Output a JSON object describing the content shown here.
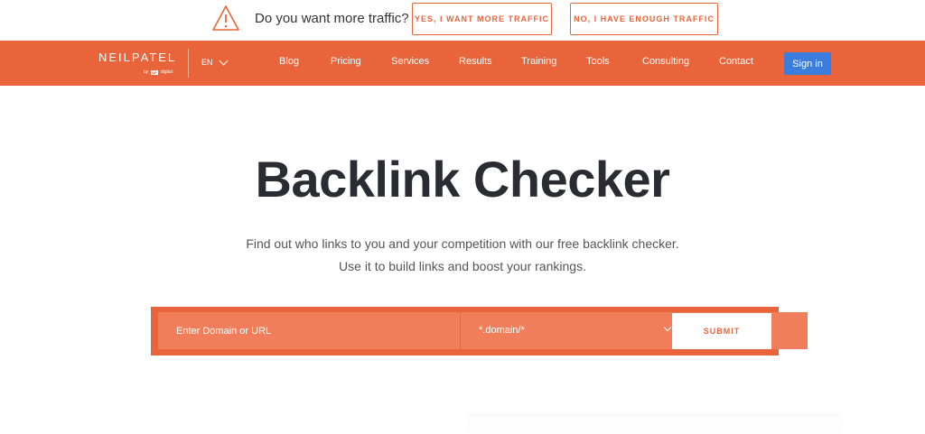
{
  "topbar": {
    "question": "Do you want more traffic?",
    "yes_label": "YES, I WANT MORE TRAFFIC",
    "no_label": "NO, I HAVE ENOUGH TRAFFIC",
    "icon": "warning-triangle-icon"
  },
  "navbar": {
    "logo_text": "NEILPATEL",
    "logo_by": "by",
    "logo_badge": "NP",
    "logo_digital": "digital",
    "language": "EN",
    "items": [
      "Blog",
      "Pricing",
      "Services",
      "Results",
      "Training",
      "Tools",
      "Consulting",
      "Contact"
    ],
    "signin_label": "Sign in"
  },
  "hero": {
    "title": "Backlink Checker",
    "subtitle_line1": "Find out who links to you and your competition with our free backlink checker.",
    "subtitle_line2": "Use it to build links and boost your rankings."
  },
  "form": {
    "input_placeholder": "Enter Domain or URL",
    "select_value": "*.domain/*",
    "submit_label": "SUBMIT"
  },
  "colors": {
    "brand_orange": "#e9643a",
    "input_orange": "#f07e5a",
    "signin_blue": "#3b7ddd"
  }
}
